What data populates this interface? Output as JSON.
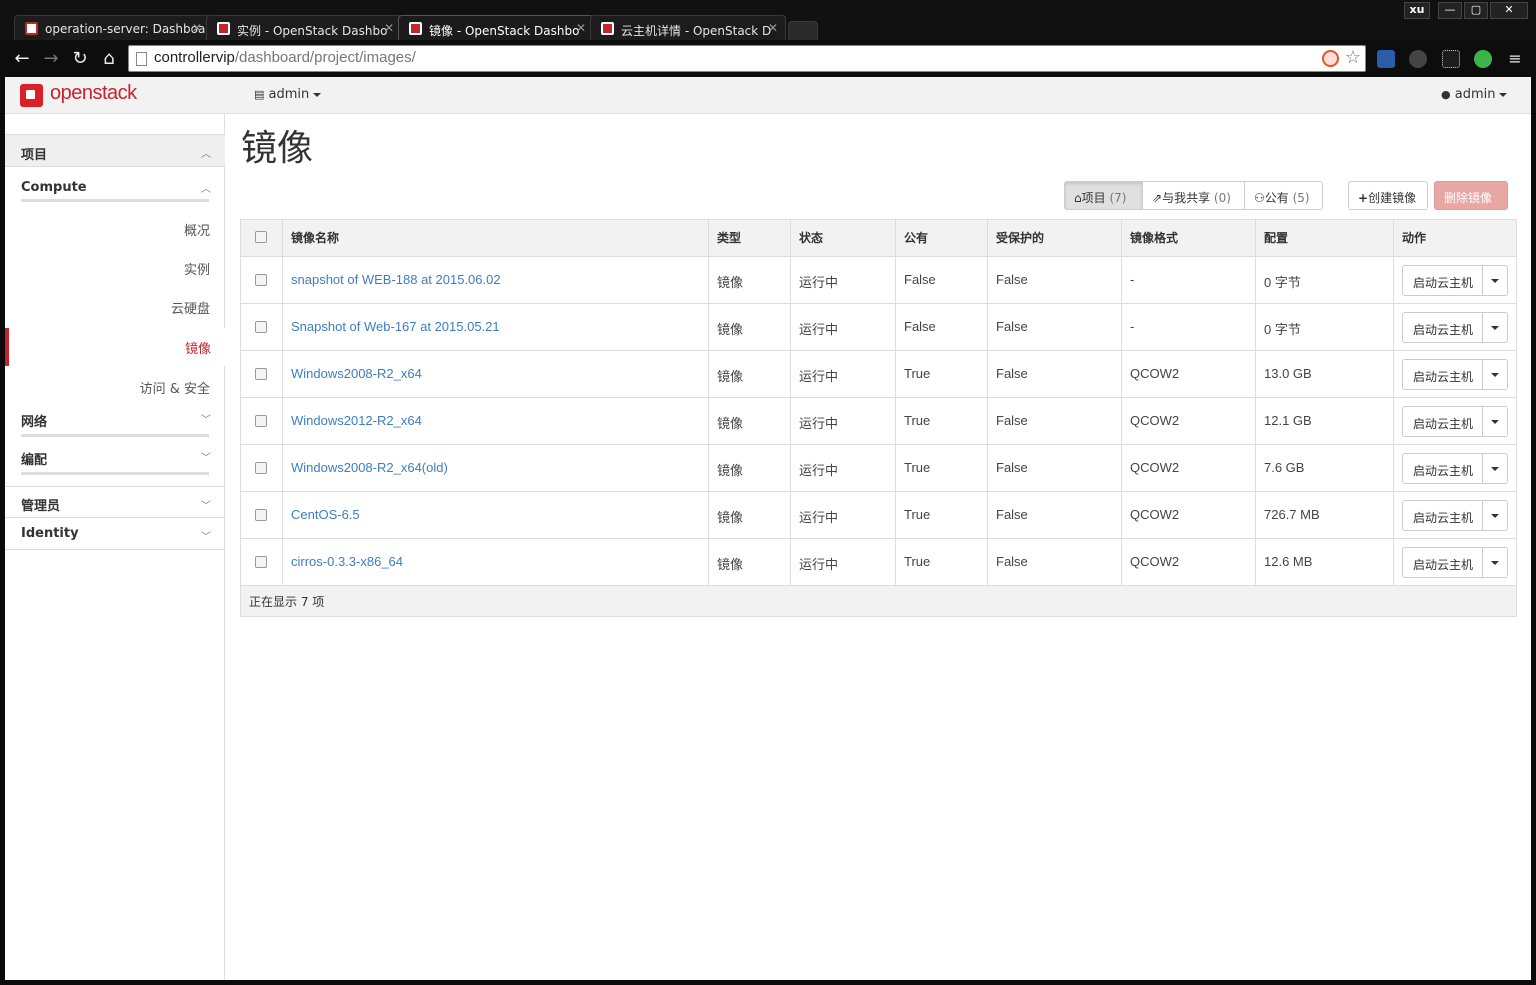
{
  "browser": {
    "tabs": [
      {
        "title": "operation-server: Dashboa"
      },
      {
        "title": "实例 - OpenStack Dashbo"
      },
      {
        "title": "镜像 - OpenStack Dashbo"
      },
      {
        "title": "云主机详情 - OpenStack D"
      }
    ],
    "profile": "xu",
    "url_host": "controllervip",
    "url_path": "/dashboard/project/images/"
  },
  "topnav": {
    "logo": "openstack",
    "project_selector": "admin",
    "user_menu": "admin"
  },
  "sidebar": {
    "project": "项目",
    "compute": "Compute",
    "items": [
      "概况",
      "实例",
      "云硬盘",
      "镜像",
      "访问 & 安全"
    ],
    "network": "网络",
    "orchestration": "编配",
    "admin": "管理员",
    "identity": "Identity"
  },
  "main": {
    "title": "镜像",
    "filters": {
      "project": "项目",
      "project_count": "(7)",
      "shared": "与我共享",
      "shared_count": "(0)",
      "public": "公有",
      "public_count": "(5)"
    },
    "create_label": "创建镜像",
    "delete_label": "删除镜像",
    "table": {
      "headers": [
        "镜像名称",
        "类型",
        "状态",
        "公有",
        "受保护的",
        "镜像格式",
        "配置",
        "动作"
      ],
      "rows": [
        {
          "name": "snapshot of WEB-188 at 2015.06.02",
          "type": "镜像",
          "status": "运行中",
          "public": "False",
          "protected": "False",
          "format": "-",
          "size": "0 字节"
        },
        {
          "name": "Snapshot of Web-167 at 2015.05.21",
          "type": "镜像",
          "status": "运行中",
          "public": "False",
          "protected": "False",
          "format": "-",
          "size": "0 字节"
        },
        {
          "name": "Windows2008-R2_x64",
          "type": "镜像",
          "status": "运行中",
          "public": "True",
          "protected": "False",
          "format": "QCOW2",
          "size": "13.0 GB"
        },
        {
          "name": "Windows2012-R2_x64",
          "type": "镜像",
          "status": "运行中",
          "public": "True",
          "protected": "False",
          "format": "QCOW2",
          "size": "12.1 GB"
        },
        {
          "name": "Windows2008-R2_x64(old)",
          "type": "镜像",
          "status": "运行中",
          "public": "True",
          "protected": "False",
          "format": "QCOW2",
          "size": "7.6 GB"
        },
        {
          "name": "CentOS-6.5",
          "type": "镜像",
          "status": "运行中",
          "public": "True",
          "protected": "False",
          "format": "QCOW2",
          "size": "726.7 MB"
        },
        {
          "name": "cirros-0.3.3-x86_64",
          "type": "镜像",
          "status": "运行中",
          "public": "True",
          "protected": "False",
          "format": "QCOW2",
          "size": "12.6 MB"
        }
      ],
      "action_label": "启动云主机",
      "footer": "正在显示 7 项"
    }
  },
  "colors": {
    "brand": "#c8232c",
    "link": "#3d7ec1",
    "danger_disabled": "#e8a6a4"
  }
}
